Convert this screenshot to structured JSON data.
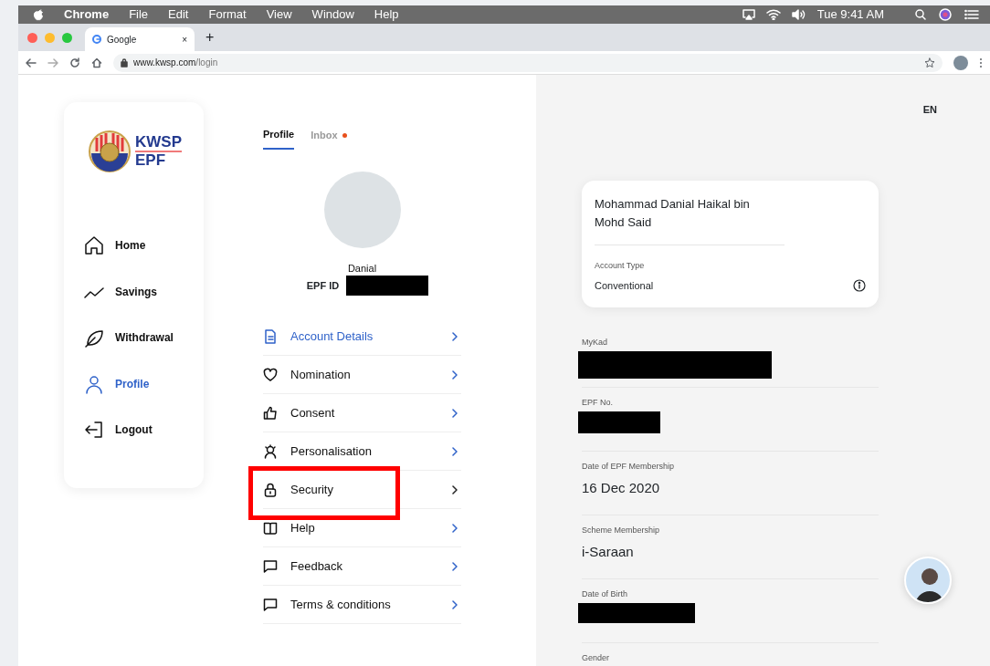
{
  "menubar": {
    "app": "Chrome",
    "menus": [
      "File",
      "Edit",
      "Format",
      "View",
      "Window",
      "Help"
    ],
    "clock": "Tue 9:41 AM"
  },
  "browser": {
    "tab_title": "Google",
    "tab_close": "×",
    "new_tab": "+",
    "url_host": "www.kwsp.com",
    "url_path": "/login"
  },
  "sidebar": {
    "logo_top": "KWSP",
    "logo_bottom": "EPF",
    "items": [
      {
        "label": "Home",
        "selected": false
      },
      {
        "label": "Savings",
        "selected": false
      },
      {
        "label": "Withdrawal",
        "selected": false
      },
      {
        "label": "Profile",
        "selected": true
      },
      {
        "label": "Logout",
        "selected": false
      }
    ]
  },
  "profile": {
    "tabs": [
      {
        "label": "Profile",
        "selected": true,
        "unread": false
      },
      {
        "label": "Inbox",
        "selected": false,
        "unread": true
      }
    ],
    "name": "Danial",
    "id_label": "EPF ID",
    "id_redacted": true,
    "menu": [
      {
        "label": "Account Details",
        "selected": true,
        "highlighted": false
      },
      {
        "label": "Nomination",
        "selected": false,
        "highlighted": false
      },
      {
        "label": "Consent",
        "selected": false,
        "highlighted": false
      },
      {
        "label": "Personalisation",
        "selected": false,
        "highlighted": false
      },
      {
        "label": "Security",
        "selected": false,
        "highlighted": true
      },
      {
        "label": "Help",
        "selected": false,
        "highlighted": false
      },
      {
        "label": "Feedback",
        "selected": false,
        "highlighted": false
      },
      {
        "label": "Terms & conditions",
        "selected": false,
        "highlighted": false
      }
    ]
  },
  "details": {
    "language": "EN",
    "card": {
      "name": "Mohammad Danial Haikal bin Mohd Said",
      "account_type_label": "Account Type",
      "account_type": "Conventional"
    },
    "fields": [
      {
        "label": "MyKad",
        "kind": "redacted"
      },
      {
        "label": "EPF No.",
        "kind": "redacted"
      },
      {
        "label": "Date of EPF Membership",
        "kind": "text",
        "value": "16 Dec 2020"
      },
      {
        "label": "Scheme Membership",
        "kind": "text",
        "value": "i-Saraan"
      },
      {
        "label": "Date of Birth",
        "kind": "redacted"
      },
      {
        "label": "Gender",
        "kind": "text"
      }
    ]
  }
}
